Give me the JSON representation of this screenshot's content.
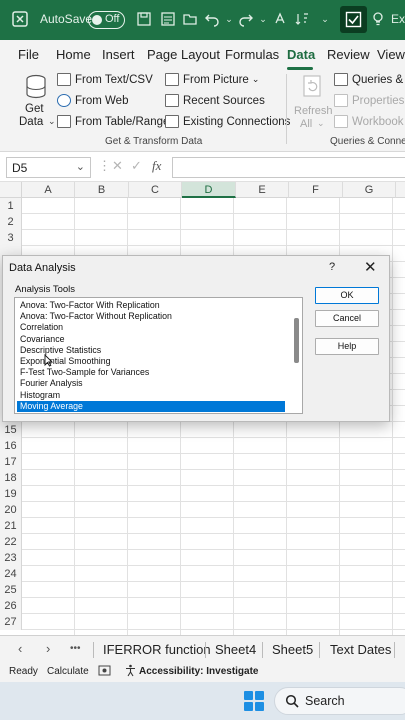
{
  "titlebar": {
    "autosave_label": "AutoSave",
    "autosave_state": "Off",
    "title_fragment": "Ex"
  },
  "ribbon_tabs": [
    "File",
    "Home",
    "Insert",
    "Page Layout",
    "Formulas",
    "Data",
    "Review",
    "View"
  ],
  "active_tab": "Data",
  "ribbon": {
    "get_data_label": "Get",
    "get_data_label2": "Data",
    "from_text_csv": "From Text/CSV",
    "from_web": "From Web",
    "from_table_range": "From Table/Range",
    "from_picture": "From Picture",
    "recent_sources": "Recent Sources",
    "existing_connections": "Existing Connections",
    "group1_label": "Get & Transform Data",
    "refresh_all": "Refresh",
    "refresh_all2": "All",
    "queries_connections": "Queries & Co",
    "properties": "Properties",
    "workbook_links": "Workbook Li",
    "group2_label": "Queries & Connect"
  },
  "formula_bar": {
    "name_box": "D5",
    "cancel_symbol": "✕",
    "enter_symbol": "✓",
    "fx_symbol": "fx",
    "content": ""
  },
  "columns": [
    "A",
    "B",
    "C",
    "D",
    "E",
    "F",
    "G"
  ],
  "selected_column": "D",
  "rows_top": [
    "1",
    "2",
    "3"
  ],
  "rows_bottom": [
    "15",
    "16",
    "17",
    "18",
    "19",
    "20",
    "21",
    "22",
    "23",
    "24",
    "25",
    "26",
    "27"
  ],
  "dialog": {
    "title": "Data Analysis",
    "help_symbol": "?",
    "close_symbol": "✕",
    "list_label": "Analysis Tools",
    "items": [
      "Anova: Two-Factor With Replication",
      "Anova: Two-Factor Without Replication",
      "Correlation",
      "Covariance",
      "Descriptive Statistics",
      "Exponential Smoothing",
      "F-Test Two-Sample for Variances",
      "Fourier Analysis",
      "Histogram",
      "Moving Average"
    ],
    "selected_item": "Moving Average",
    "ok_label": "OK",
    "cancel_label": "Cancel",
    "help_label": "Help"
  },
  "sheet_tabs": {
    "more": "•••",
    "tabs": [
      "IFERROR function",
      "Sheet4",
      "Sheet5",
      "Text Dates"
    ]
  },
  "statusbar": {
    "ready": "Ready",
    "calculate": "Calculate",
    "accessibility": "Accessibility: Investigate"
  },
  "taskbar": {
    "search_label": "Search"
  },
  "colors": {
    "excel_green": "#1e7145",
    "selection_blue": "#0078d7"
  }
}
